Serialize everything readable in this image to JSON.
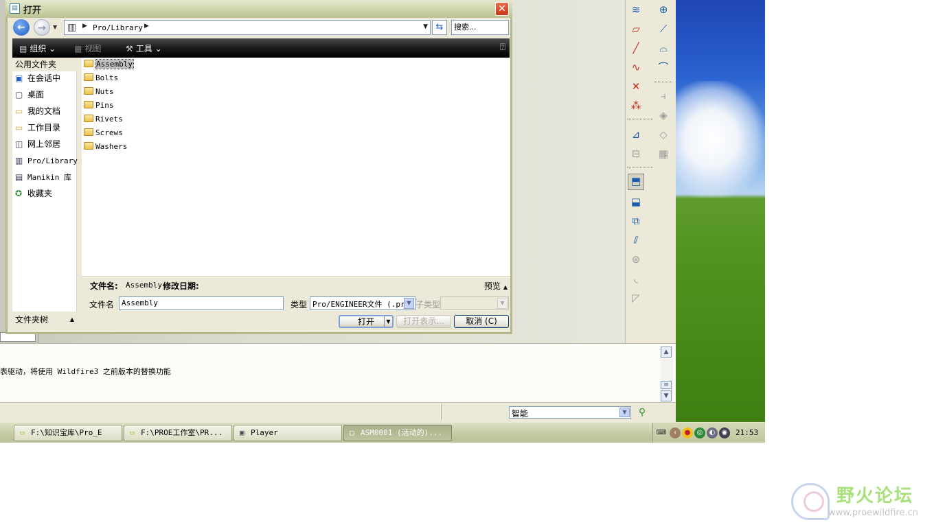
{
  "dialog": {
    "title": "打开",
    "address_path": "Pro/Library",
    "search_placeholder": "搜索...",
    "commands": {
      "organize": "组织",
      "views": "视图",
      "tools": "工具"
    },
    "favorites_header": "公用文件夹",
    "favorites": [
      {
        "label": "在会话中",
        "icon": "session-icon"
      },
      {
        "label": "桌面",
        "icon": "desktop-icon"
      },
      {
        "label": "我的文档",
        "icon": "documents-icon"
      },
      {
        "label": "工作目录",
        "icon": "working-dir-icon"
      },
      {
        "label": "网上邻居",
        "icon": "network-icon"
      },
      {
        "label": "Pro/Library",
        "icon": "library-icon"
      },
      {
        "label": "Manikin 库",
        "icon": "manikin-icon"
      },
      {
        "label": "收藏夹",
        "icon": "favorites-icon"
      }
    ],
    "folder_tree_label": "文件夹树",
    "files": [
      "Assembly",
      "Bolts",
      "Nuts",
      "Pins",
      "Rivets",
      "Screws",
      "Washers"
    ],
    "selected_file": "Assembly",
    "details": {
      "name_label": "文件名:",
      "name_value": "Assembly",
      "modified_label": "修改日期:",
      "preview_label": "预览"
    },
    "filename_label": "文件名",
    "filename_value": "Assembly",
    "type_label": "类型",
    "type_value": "Pro/ENGINEER文件 (.prt",
    "subtype_label": "子类型",
    "buttons": {
      "open": "打开",
      "open_repr": "打开表示...",
      "cancel": "取消 (C)"
    }
  },
  "message_area": {
    "text": "表驱动，将使用 Wildfire3 之前版本的替换功能"
  },
  "status_bar": {
    "filter_value": "智能"
  },
  "taskbar": {
    "items": [
      {
        "label": "F:\\知识宝库\\Pro_E",
        "active": false
      },
      {
        "label": "F:\\PROE工作室\\PR...",
        "active": false
      },
      {
        "label": "Player",
        "active": false
      },
      {
        "label": "ASM0001 (活动的)...",
        "active": true
      }
    ],
    "clock": "21:53"
  },
  "watermark": {
    "title": "野火论坛",
    "url": "www.proewildfire.cn"
  }
}
